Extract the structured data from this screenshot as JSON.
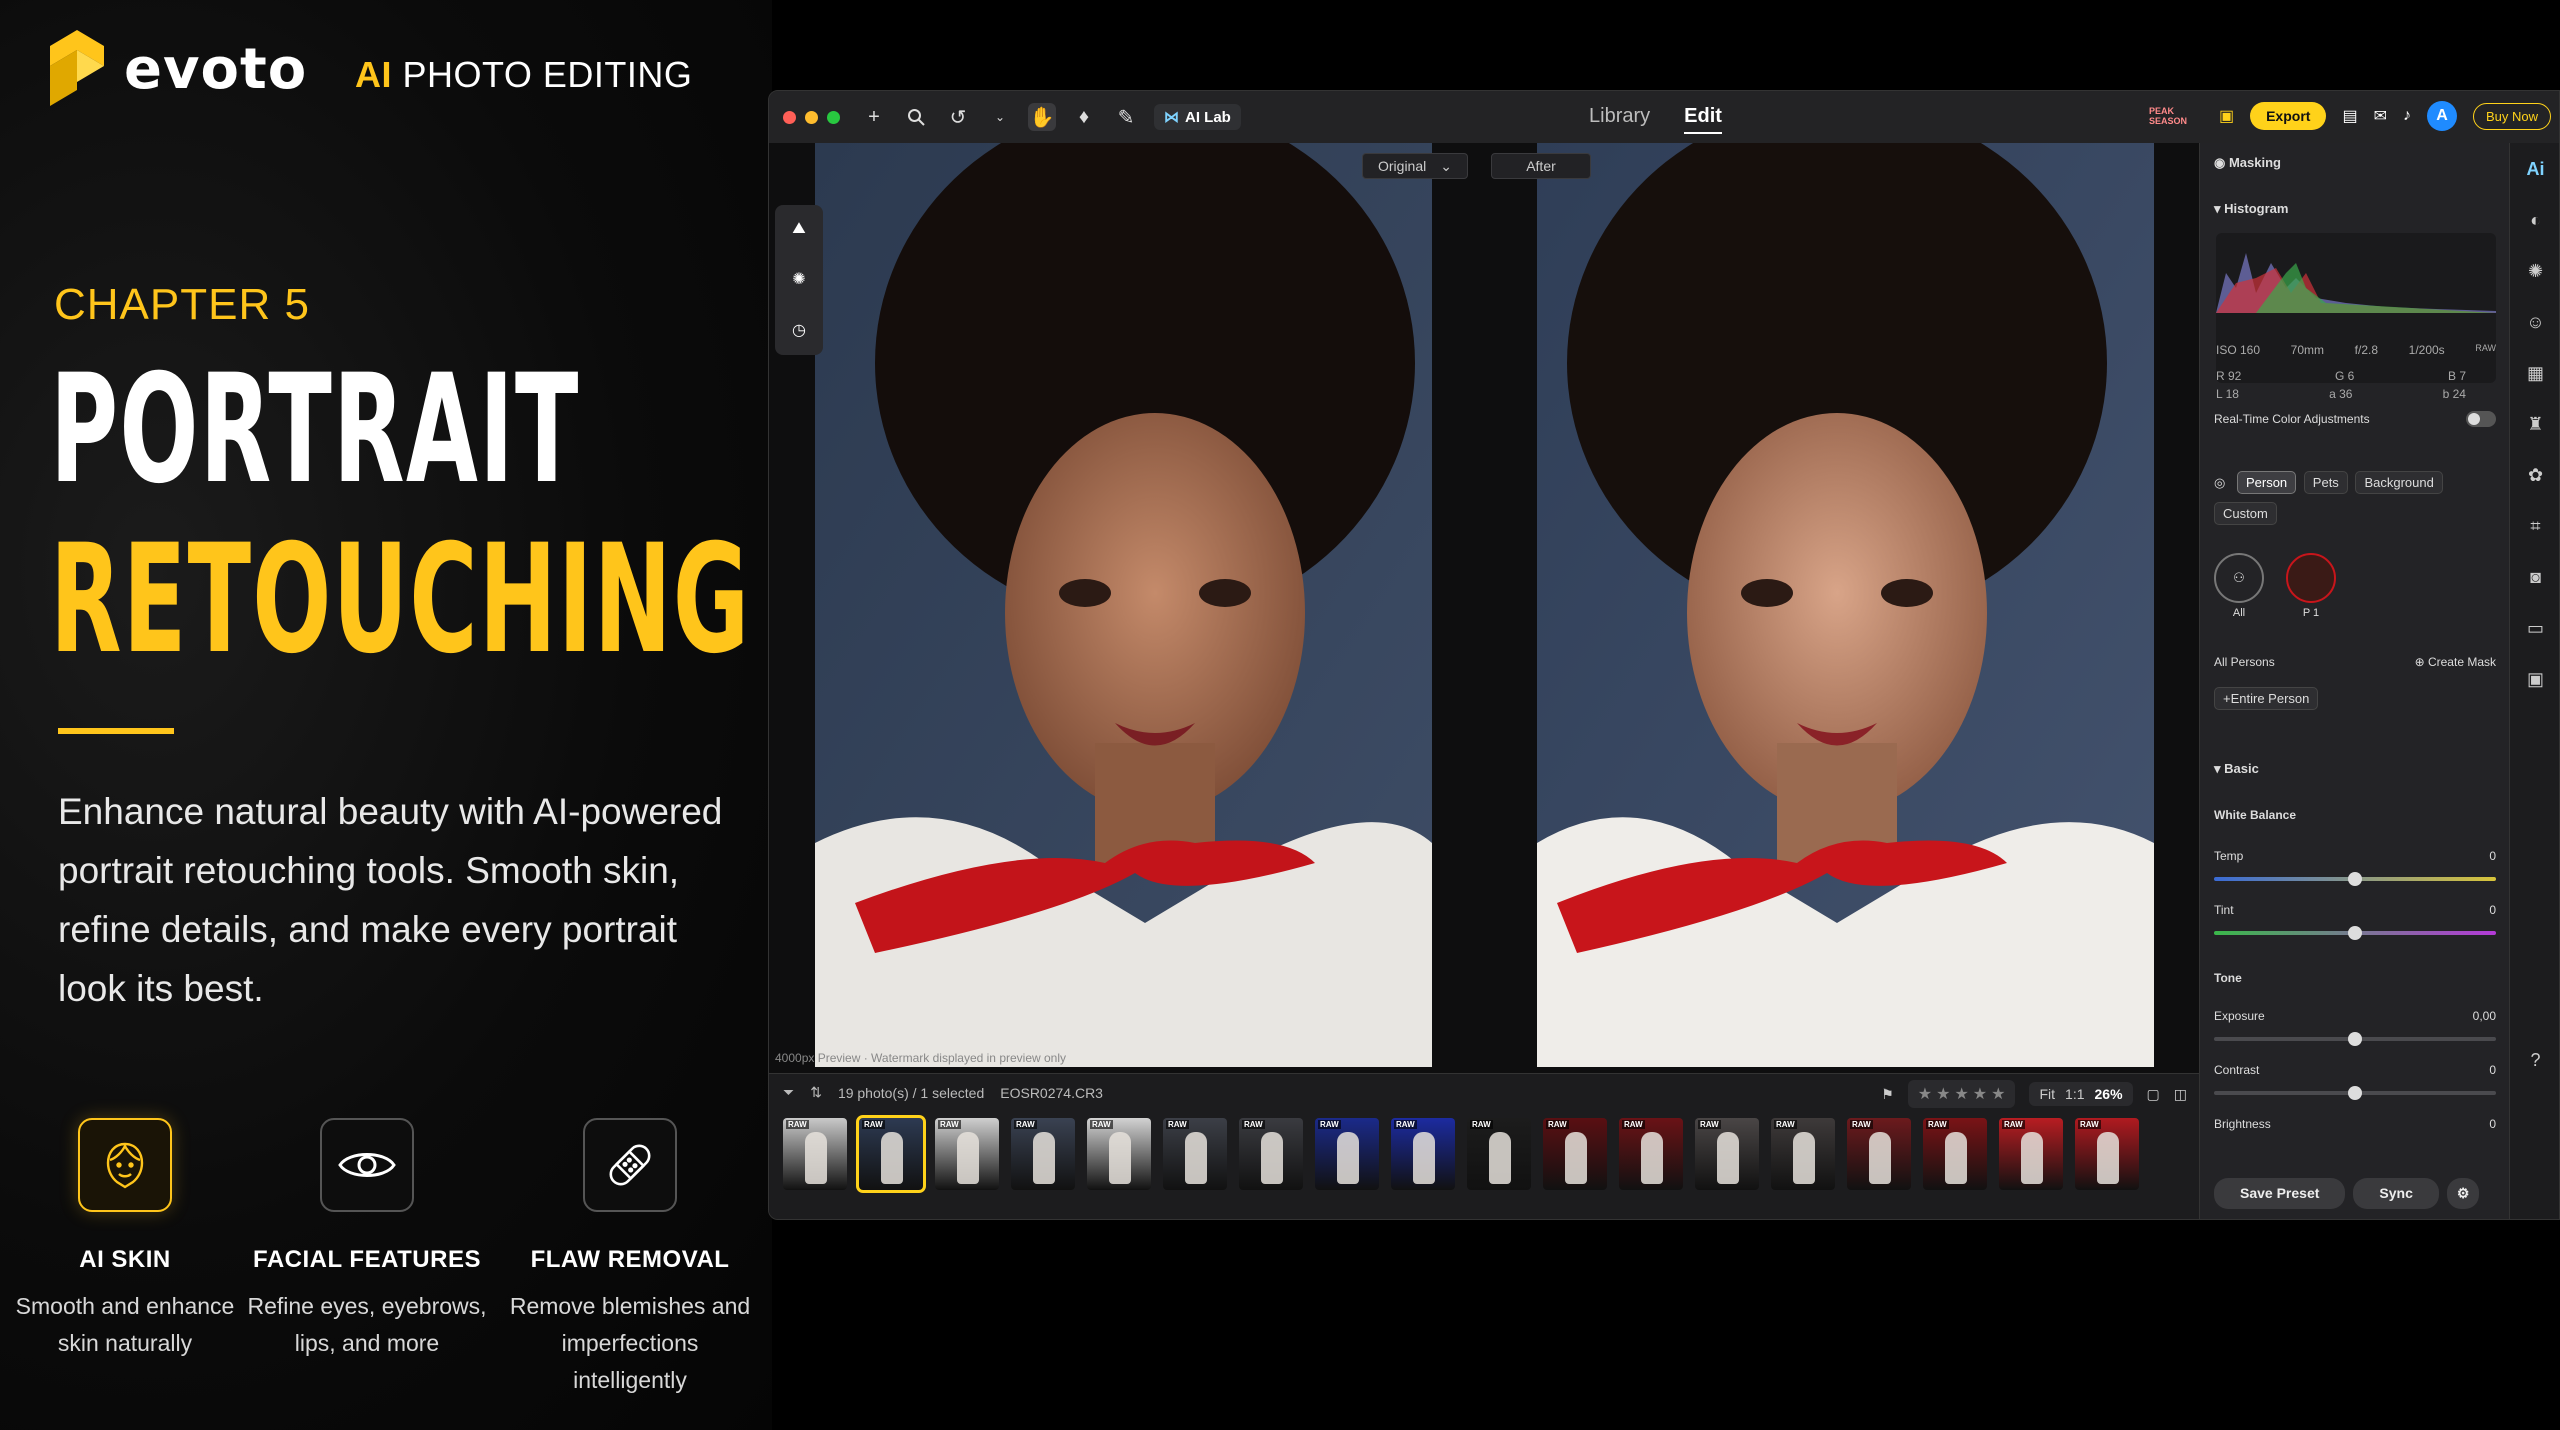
{
  "brand": {
    "name": "evoto",
    "tagline_ai": "AI",
    "tagline_rest": " PHOTO EDITING",
    "accent": "#ffc51b"
  },
  "hero": {
    "chapter": "CHAPTER 5",
    "title_line1": "PORTRAIT",
    "title_line2": "RETOUCHING",
    "description": "Enhance natural beauty with AI-powered portrait retouching tools. Smooth skin, refine details, and make every portrait look its best."
  },
  "features": [
    {
      "title": "AI SKIN",
      "desc": "Smooth and enhance skin naturally",
      "icon": "face-smile-icon"
    },
    {
      "title": "FACIAL FEATURES",
      "desc": "Refine eyes, eyebrows, lips, and more",
      "icon": "eye-icon"
    },
    {
      "title": "FLAW REMOVAL",
      "desc": "Remove blemishes and imperfections intelligently",
      "icon": "bandage-icon"
    }
  ],
  "app": {
    "toolbar": {
      "ailab": "AI Lab",
      "peak": "PEAK SEASON",
      "export": "Export",
      "avatar": "A",
      "buy": "Buy Now"
    },
    "tabs": {
      "library": "Library",
      "edit": "Edit"
    },
    "compare": {
      "original": "Original",
      "after": "After"
    },
    "preview_note": "4000px Preview · Watermark displayed in preview only",
    "filmstrip": {
      "count": "19 photo(s) / 1 selected",
      "filename": "EOSR0274.CR3",
      "fit": "Fit",
      "one": "1:1",
      "zoom": "26%",
      "raw": "RAW",
      "thumbs": [
        {
          "color": "#c9c9c9"
        },
        {
          "color": "#2d3a52",
          "sel": true
        },
        {
          "color": "#cfcfcf"
        },
        {
          "color": "#3a4252"
        },
        {
          "color": "#d2d2d2"
        },
        {
          "color": "#3c3f47"
        },
        {
          "color": "#3a3b40"
        },
        {
          "color": "#1b2a8a"
        },
        {
          "color": "#1c2ba0"
        },
        {
          "color": "#1c1c1c"
        },
        {
          "color": "#5a0f12"
        },
        {
          "color": "#6a1216"
        },
        {
          "color": "#4a4646"
        },
        {
          "color": "#3e3a3a"
        },
        {
          "color": "#6c1a1d"
        },
        {
          "color": "#7a1316"
        },
        {
          "color": "#b81d22"
        },
        {
          "color": "#b01a20"
        }
      ]
    },
    "panel": {
      "masking": "Masking",
      "histogram": "Histogram",
      "exif": [
        "ISO 160",
        "70mm",
        "f/2.8",
        "1/200s"
      ],
      "raw_badge": "RAW",
      "rgb": [
        "R 92",
        "G 6",
        "B 7"
      ],
      "lab": [
        "L 18",
        "a 36",
        "b 24"
      ],
      "realtime": "Real-Time Color Adjustments",
      "chips": [
        "Person",
        "Pets",
        "Background",
        "Custom"
      ],
      "all_label": "All",
      "p1_label": "P 1",
      "all_persons": "All Persons",
      "create_mask": "Create Mask",
      "entire_person": "+Entire Person",
      "basic": "Basic",
      "white_balance": "White Balance",
      "temp": "Temp",
      "temp_val": "0",
      "tint": "Tint",
      "tint_val": "0",
      "tone": "Tone",
      "exposure": "Exposure",
      "exposure_val": "0,00",
      "contrast": "Contrast",
      "contrast_val": "0",
      "brightness": "Brightness",
      "brightness_val": "0",
      "save_preset": "Save Preset",
      "sync": "Sync"
    },
    "side_icons": [
      "ai-icon",
      "palette-icon",
      "retouch-icon",
      "face-icon",
      "background-icon",
      "clothing-icon",
      "pet-icon",
      "crop-icon",
      "camera-icon",
      "folder-icon",
      "bookmark-icon",
      "help-icon"
    ]
  }
}
